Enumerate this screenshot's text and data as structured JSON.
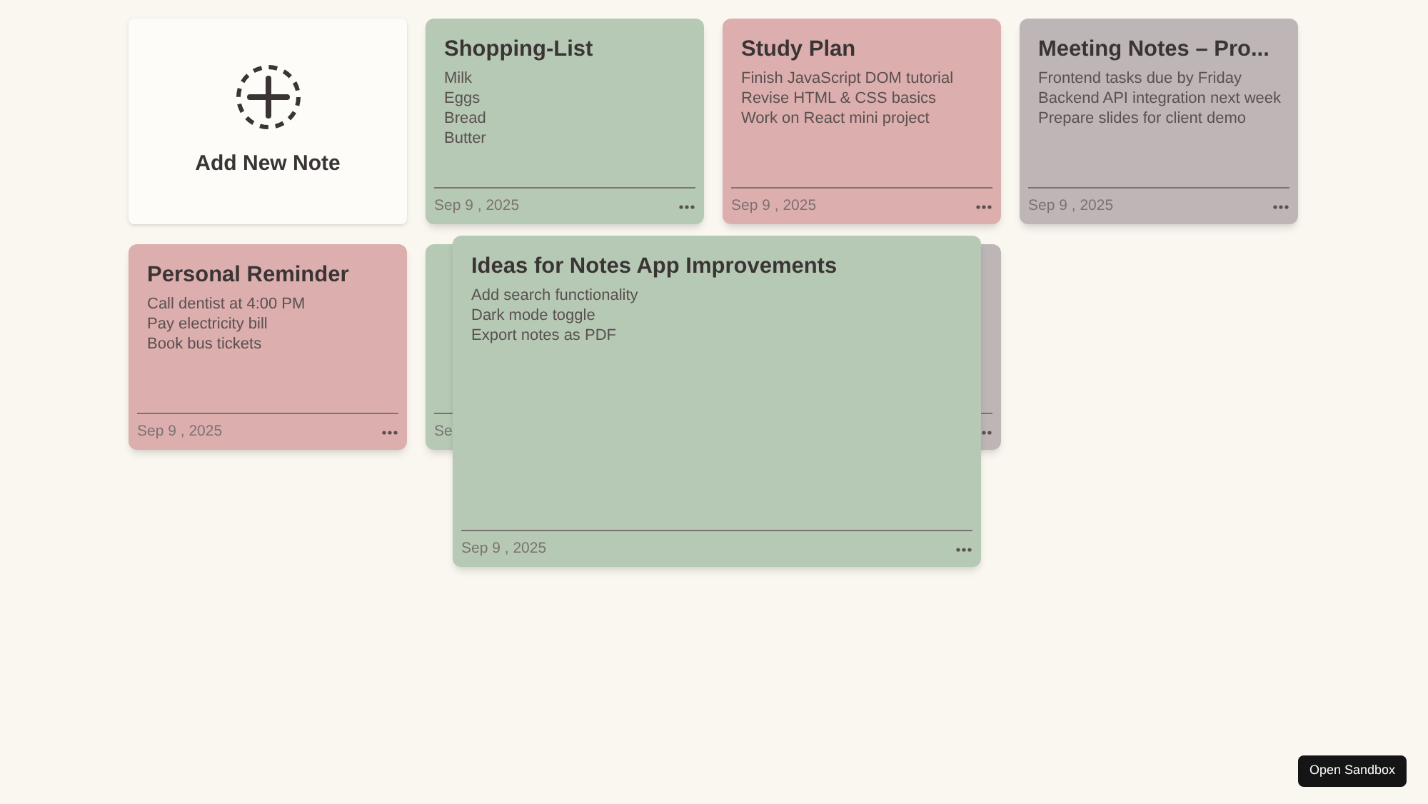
{
  "add_note": {
    "label": "Add New Note"
  },
  "notes": [
    {
      "title": "Shopping-List",
      "lines": [
        "Milk",
        "Eggs",
        "Bread",
        "Butter"
      ],
      "date": "Sep 9 , 2025",
      "color": "#b5c9b4"
    },
    {
      "title": "Study Plan",
      "lines": [
        "Finish JavaScript DOM tutorial",
        "Revise HTML & CSS basics",
        "Work on React mini project"
      ],
      "date": "Sep 9 , 2025",
      "color": "#dcaeae"
    },
    {
      "title": "Meeting Notes – Pro...",
      "lines": [
        "Frontend tasks due by Friday",
        "Backend API integration next week",
        "Prepare slides for client demo"
      ],
      "date": "Sep 9 , 2025",
      "color": "#bdb5b6"
    },
    {
      "title": "Personal Reminder",
      "lines": [
        "Call dentist at 4:00 PM",
        "Pay electricity bill",
        "Book bus tickets"
      ],
      "date": "Sep 9 , 2025",
      "color": "#dcaeae"
    },
    {
      "date": "Se",
      "color": "#b5c9b4"
    },
    {
      "color": "#bdb5b6"
    }
  ],
  "expanded_note": {
    "title": "Ideas for Notes App Improvements",
    "lines": [
      "Add search functionality",
      "Dark mode toggle",
      "Export notes as PDF"
    ],
    "date": "Sep 9 , 2025",
    "color": "#b5c9b4"
  },
  "sandbox_button": {
    "label": "Open Sandbox"
  }
}
